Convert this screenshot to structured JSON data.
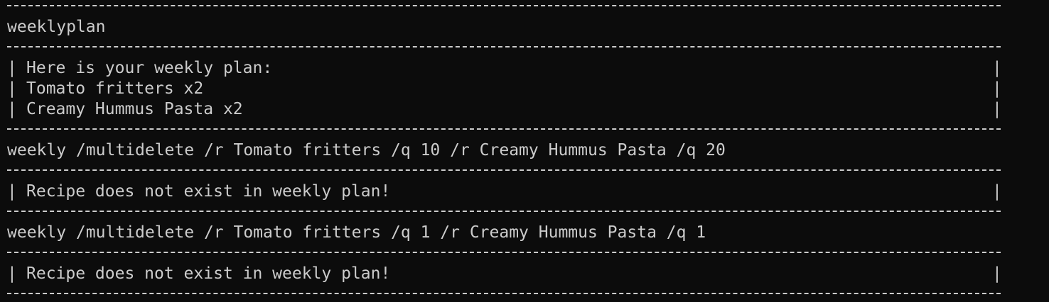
{
  "terminal": {
    "commands": [
      "weeklyplan",
      "weekly /multidelete /r Tomato fritters /q 10 /r Creamy Hummus Pasta /q 20",
      "weekly /multidelete /r Tomato fritters /q 1 /r Creamy Hummus Pasta /q 1"
    ],
    "responses": [
      [
        "Here is your weekly plan:",
        "Tomato fritters x2",
        "Creamy Hummus Pasta x2"
      ],
      [
        "Recipe does not exist in weekly plan!"
      ],
      [
        "Recipe does not exist in weekly plan!"
      ]
    ],
    "border_char": "|",
    "colors": {
      "background": "#0c0c0c",
      "foreground": "#cccccc"
    }
  }
}
